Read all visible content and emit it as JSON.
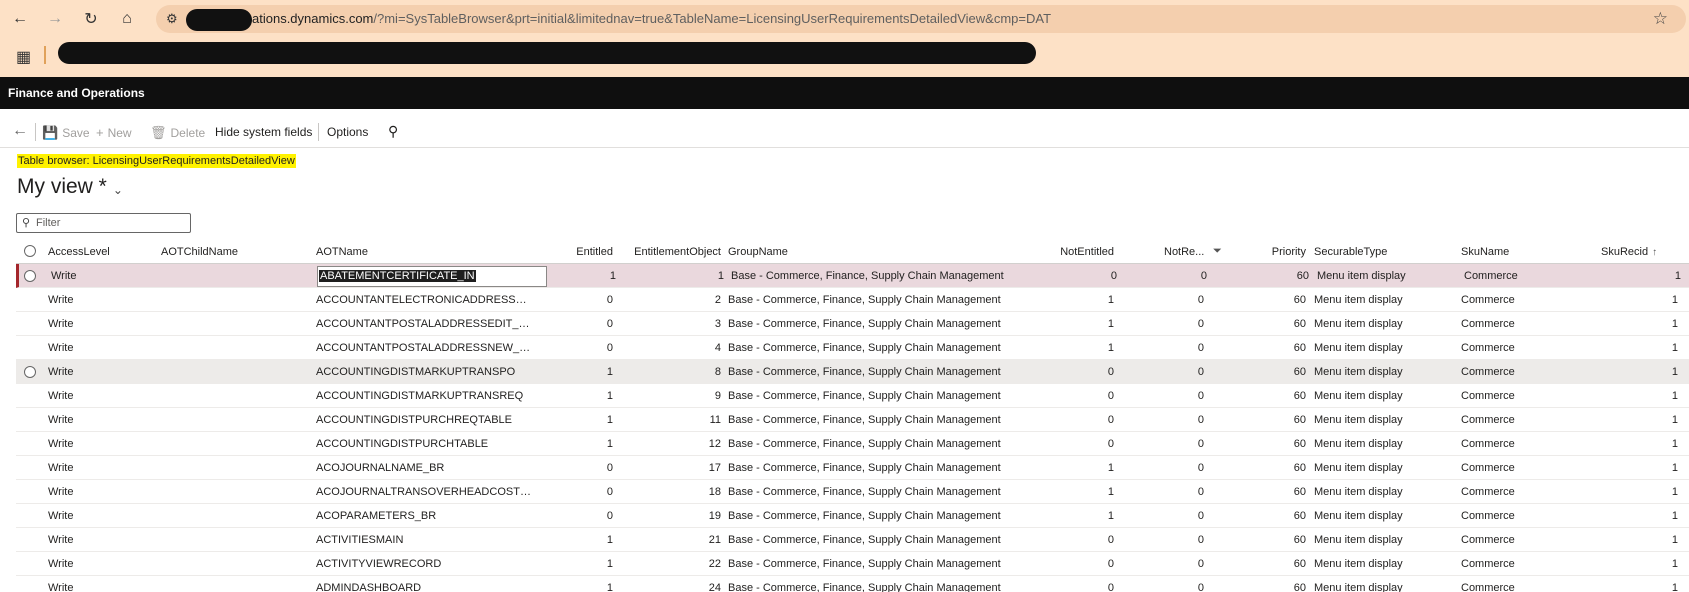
{
  "browser": {
    "url_host": "ations.dynamics.com",
    "url_path": "/?mi=SysTableBrowser&prt=initial&limitednav=true&TableName=LicensingUserRequirementsDetailedView&cmp=DAT",
    "icons": {
      "back": "arrow-left-icon",
      "forward": "arrow-right-icon",
      "reload": "reload-icon",
      "home": "home-icon",
      "site": "site-settings-icon",
      "star": "bookmark-star-icon",
      "apps": "apps-grid-icon"
    }
  },
  "app": {
    "title": "Finance and Operations"
  },
  "action_pane": {
    "save": "Save",
    "new": "New",
    "delete": "Delete",
    "hide_system_fields": "Hide system fields",
    "options": "Options"
  },
  "page": {
    "caption": "Table browser: LicensingUserRequirementsDetailedView",
    "view_title": "My view *",
    "filter_placeholder": "Filter"
  },
  "grid": {
    "columns": {
      "access_level": "AccessLevel",
      "aot_child_name": "AOTChildName",
      "aot_name": "AOTName",
      "entitled": "Entitled",
      "entitlement_object": "EntitlementObject",
      "group_name": "GroupName",
      "not_entitled": "NotEntitled",
      "not_re": "NotRe...",
      "priority": "Priority",
      "securable_type": "SecurableType",
      "sku_name": "SkuName",
      "sku_recid": "SkuRecid"
    },
    "rows": [
      {
        "access": "Write",
        "child": "",
        "aot": "ABATEMENTCERTIFICATE_IN",
        "entitled": "1",
        "eo": "1",
        "group": "Base - Commerce, Finance, Supply Chain Management",
        "ne": "0",
        "nr": "0",
        "priority": "60",
        "stype": "Menu item display",
        "sku": "Commerce",
        "recid": "1"
      },
      {
        "access": "Write",
        "child": "",
        "aot": "ACCOUNTANTELECTRONICADDRESSNE...",
        "entitled": "0",
        "eo": "2",
        "group": "Base - Commerce, Finance, Supply Chain Management",
        "ne": "1",
        "nr": "0",
        "priority": "60",
        "stype": "Menu item display",
        "sku": "Commerce",
        "recid": "1"
      },
      {
        "access": "Write",
        "child": "",
        "aot": "ACCOUNTANTPOSTALADDRESSEDIT_BR",
        "entitled": "0",
        "eo": "3",
        "group": "Base - Commerce, Finance, Supply Chain Management",
        "ne": "1",
        "nr": "0",
        "priority": "60",
        "stype": "Menu item display",
        "sku": "Commerce",
        "recid": "1"
      },
      {
        "access": "Write",
        "child": "",
        "aot": "ACCOUNTANTPOSTALADDRESSNEW_BR",
        "entitled": "0",
        "eo": "4",
        "group": "Base - Commerce, Finance, Supply Chain Management",
        "ne": "1",
        "nr": "0",
        "priority": "60",
        "stype": "Menu item display",
        "sku": "Commerce",
        "recid": "1"
      },
      {
        "access": "Write",
        "child": "",
        "aot": "ACCOUNTINGDISTMARKUPTRANSPO",
        "entitled": "1",
        "eo": "8",
        "group": "Base - Commerce, Finance, Supply Chain Management",
        "ne": "0",
        "nr": "0",
        "priority": "60",
        "stype": "Menu item display",
        "sku": "Commerce",
        "recid": "1"
      },
      {
        "access": "Write",
        "child": "",
        "aot": "ACCOUNTINGDISTMARKUPTRANSREQ",
        "entitled": "1",
        "eo": "9",
        "group": "Base - Commerce, Finance, Supply Chain Management",
        "ne": "0",
        "nr": "0",
        "priority": "60",
        "stype": "Menu item display",
        "sku": "Commerce",
        "recid": "1"
      },
      {
        "access": "Write",
        "child": "",
        "aot": "ACCOUNTINGDISTPURCHREQTABLE",
        "entitled": "1",
        "eo": "11",
        "group": "Base - Commerce, Finance, Supply Chain Management",
        "ne": "0",
        "nr": "0",
        "priority": "60",
        "stype": "Menu item display",
        "sku": "Commerce",
        "recid": "1"
      },
      {
        "access": "Write",
        "child": "",
        "aot": "ACCOUNTINGDISTPURCHTABLE",
        "entitled": "1",
        "eo": "12",
        "group": "Base - Commerce, Finance, Supply Chain Management",
        "ne": "0",
        "nr": "0",
        "priority": "60",
        "stype": "Menu item display",
        "sku": "Commerce",
        "recid": "1"
      },
      {
        "access": "Write",
        "child": "",
        "aot": "ACOJOURNALNAME_BR",
        "entitled": "0",
        "eo": "17",
        "group": "Base - Commerce, Finance, Supply Chain Management",
        "ne": "1",
        "nr": "0",
        "priority": "60",
        "stype": "Menu item display",
        "sku": "Commerce",
        "recid": "1"
      },
      {
        "access": "Write",
        "child": "",
        "aot": "ACOJOURNALTRANSOVERHEADCOSTS_BR",
        "entitled": "0",
        "eo": "18",
        "group": "Base - Commerce, Finance, Supply Chain Management",
        "ne": "1",
        "nr": "0",
        "priority": "60",
        "stype": "Menu item display",
        "sku": "Commerce",
        "recid": "1"
      },
      {
        "access": "Write",
        "child": "",
        "aot": "ACOPARAMETERS_BR",
        "entitled": "0",
        "eo": "19",
        "group": "Base - Commerce, Finance, Supply Chain Management",
        "ne": "1",
        "nr": "0",
        "priority": "60",
        "stype": "Menu item display",
        "sku": "Commerce",
        "recid": "1"
      },
      {
        "access": "Write",
        "child": "",
        "aot": "ACTIVITIESMAIN",
        "entitled": "1",
        "eo": "21",
        "group": "Base - Commerce, Finance, Supply Chain Management",
        "ne": "0",
        "nr": "0",
        "priority": "60",
        "stype": "Menu item display",
        "sku": "Commerce",
        "recid": "1"
      },
      {
        "access": "Write",
        "child": "",
        "aot": "ACTIVITYVIEWRECORD",
        "entitled": "1",
        "eo": "22",
        "group": "Base - Commerce, Finance, Supply Chain Management",
        "ne": "0",
        "nr": "0",
        "priority": "60",
        "stype": "Menu item display",
        "sku": "Commerce",
        "recid": "1"
      },
      {
        "access": "Write",
        "child": "",
        "aot": "ADMINDASHBOARD",
        "entitled": "1",
        "eo": "24",
        "group": "Base - Commerce, Finance, Supply Chain Management",
        "ne": "0",
        "nr": "0",
        "priority": "60",
        "stype": "Menu item display",
        "sku": "Commerce",
        "recid": "1"
      }
    ]
  }
}
